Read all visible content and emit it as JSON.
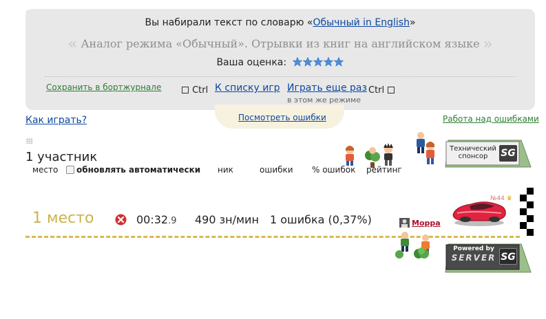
{
  "result_panel": {
    "dictionary_prefix": "Вы набирали текст по словарю «",
    "dictionary_name": "Обычный in English",
    "dictionary_suffix": "»",
    "description": "Аналог режима «Обычный». Отрывки из книг на английском языке",
    "rating_label": "Ваша оценка:",
    "rating_stars": 5,
    "save_link": "Сохранить в бортжурнале",
    "ctrl_label_left": "Ctrl",
    "games_list_link": "К списку игр",
    "play_again_link": "Играть еще раз",
    "ctrl_label_right": "Ctrl",
    "same_mode_note": "в этом же режиме"
  },
  "links": {
    "view_errors": "Посмотреть ошибки",
    "how_to_play": "Как играть?",
    "work_on_errors": "Работа над ошибками"
  },
  "participants": {
    "count_label": "1 участник",
    "columns": {
      "place": "место",
      "auto_refresh": "обновлять автоматически",
      "nick": "ник",
      "errors": "ошибки",
      "error_percent": "% ошибок",
      "rating": "рейтинг"
    }
  },
  "sponsor": {
    "line1": "Технический",
    "line2": "спонсор",
    "logo": "SG"
  },
  "result_row": {
    "place": "1 место",
    "time_main": "00:32",
    "time_fraction": ".9",
    "speed": "490 зн/мин",
    "errors": "1 ошибка (0,37%)",
    "nick": "Морра",
    "rank": "№44"
  },
  "powered": {
    "line1": "Powered by",
    "line2": "SERVER",
    "logo": "SG"
  },
  "colors": {
    "panel_bg": "#e8e8e8",
    "link_blue": "#0d47a1",
    "link_green": "#2e7d32",
    "place_gold": "#c9b44e",
    "track_gold": "#d9b94a",
    "nick_red": "#a8102b",
    "car_red": "#e0233f",
    "star_blue": "#4a8fe0"
  },
  "icons": [
    "star-icon",
    "error-icon",
    "avatar-icon",
    "car-icon",
    "finish-flag-icon"
  ]
}
